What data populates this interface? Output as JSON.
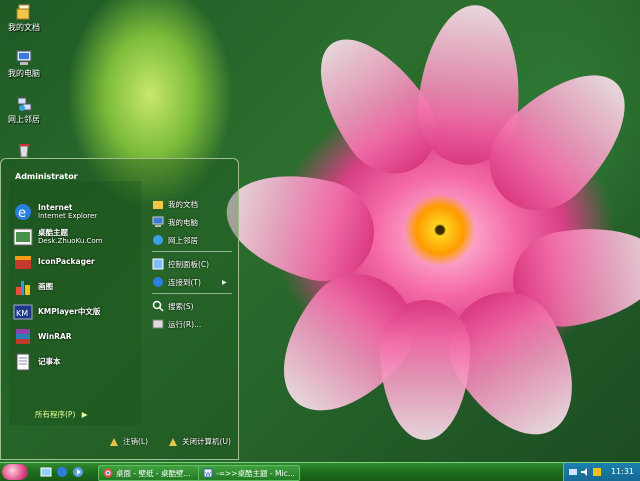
{
  "desktop_icons": [
    {
      "label": "我的文档",
      "icon": "my-documents-icon"
    },
    {
      "label": "我的电脑",
      "icon": "my-computer-icon"
    },
    {
      "label": "网上邻居",
      "icon": "network-places-icon"
    },
    {
      "label": "",
      "icon": "recycle-bin-icon"
    }
  ],
  "start_menu": {
    "user": "Administrator",
    "pinned": [
      {
        "label": "Internet",
        "sub": "Internet Explorer",
        "icon": "internet-explorer-icon"
      },
      {
        "label": "桌酷主题",
        "sub": "Desk.ZhuoKu.Com",
        "icon": "zhuoku-icon"
      }
    ],
    "recent": [
      {
        "label": "IconPackager",
        "icon": "iconpackager-icon"
      },
      {
        "label": "画图",
        "icon": "paint-icon"
      },
      {
        "label": "KMPlayer中文版",
        "icon": "kmplayer-icon"
      },
      {
        "label": "WinRAR",
        "icon": "winrar-icon"
      },
      {
        "label": "记事本",
        "icon": "notepad-icon"
      }
    ],
    "all_programs": "所有程序(P)",
    "right_items": [
      {
        "label": "我的文档",
        "icon": "my-documents-icon"
      },
      {
        "label": "我的电脑",
        "icon": "my-computer-icon"
      },
      {
        "label": "网上邻居",
        "icon": "network-places-icon"
      },
      {
        "label": "控制面板(C)",
        "icon": "control-panel-icon"
      },
      {
        "label": "连接到(T)",
        "icon": "connect-icon"
      },
      {
        "label": "搜索(S)",
        "icon": "search-icon"
      },
      {
        "label": "运行(R)...",
        "icon": "run-icon"
      }
    ],
    "logoff": "注销(L)",
    "shutdown": "关闭计算机(U)"
  },
  "taskbar": {
    "tasks": [
      {
        "label": "桌面 - 壁纸 - 桌酷壁...",
        "icon": "chrome-icon"
      },
      {
        "label": "-=>>桌酷主题 - Mic...",
        "icon": "word-doc-icon"
      }
    ],
    "clock": "11:31"
  },
  "colors": {
    "taskbar": "#1e6e1e",
    "tray": "#156b94",
    "accent": "#e04b86"
  }
}
